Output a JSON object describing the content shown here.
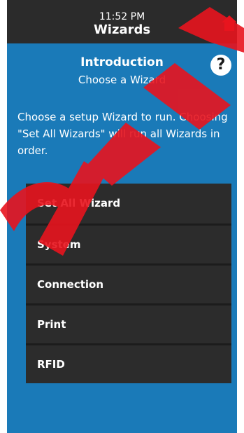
{
  "status": {
    "time": "11:52 PM"
  },
  "header": {
    "title": "Wizards",
    "home_icon": "home-icon"
  },
  "intro": {
    "heading": "Introduction",
    "subheading": "Choose a Wizard",
    "help_label": "?",
    "description": "Choose a setup Wizard to run. Choosing \"Set All Wizards\" will run all Wizards in order."
  },
  "wizards": [
    {
      "label": "Set All Wizard"
    },
    {
      "label": "System"
    },
    {
      "label": "Connection"
    },
    {
      "label": "Print"
    },
    {
      "label": "RFID"
    }
  ],
  "colors": {
    "accent": "#1a7ab8",
    "bar": "#2b2b2b",
    "watermark": "#e8141e"
  }
}
